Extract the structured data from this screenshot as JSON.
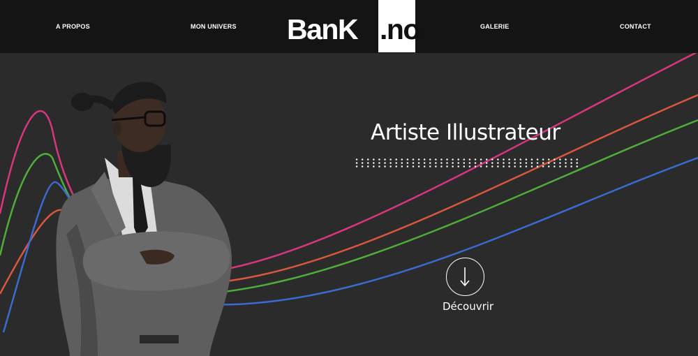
{
  "nav": {
    "items": [
      {
        "label": "A PROPOS"
      },
      {
        "label": "MON UNIVERS"
      },
      {
        "label": "GALERIE"
      },
      {
        "label": "CONTACT"
      }
    ]
  },
  "logo": {
    "part1": "BanK",
    "part2": ".no"
  },
  "hero": {
    "title": "Artiste Illustrateur",
    "cta_label": "Découvrir"
  },
  "colors": {
    "header_bg": "#141414",
    "hero_bg": "#2b2b2c",
    "line_pink": "#d8367e",
    "line_red": "#d9563f",
    "line_green": "#4fae3a",
    "line_blue": "#3a6bd0"
  },
  "icons": {
    "cta": "arrow-down-icon"
  }
}
